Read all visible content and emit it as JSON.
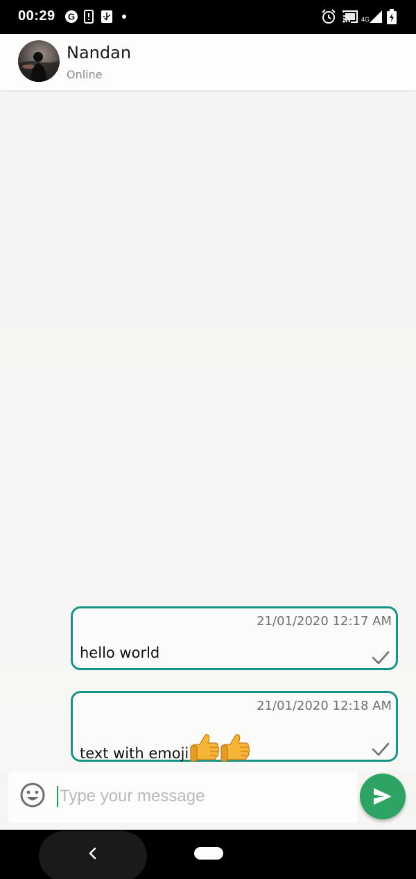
{
  "status_bar": {
    "time": "00:29",
    "network": "4G"
  },
  "header": {
    "contact_name": "Nandan",
    "contact_status": "Online"
  },
  "messages": [
    {
      "timestamp": "21/01/2020 12:17 AM",
      "text": "hello world",
      "emoji": "",
      "status": "sent"
    },
    {
      "timestamp": "21/01/2020 12:18 AM",
      "text": "text with emoji",
      "emoji": "👍👍",
      "status": "sent"
    }
  ],
  "composer": {
    "placeholder": "Type your message",
    "value": ""
  },
  "colors": {
    "bubble_border": "#179488",
    "send_button": "#2ea464",
    "background": "#f5f6f3"
  },
  "icons": {
    "emoji_button": "smiley-icon",
    "send_button": "send-icon",
    "message_status": "check-icon"
  }
}
